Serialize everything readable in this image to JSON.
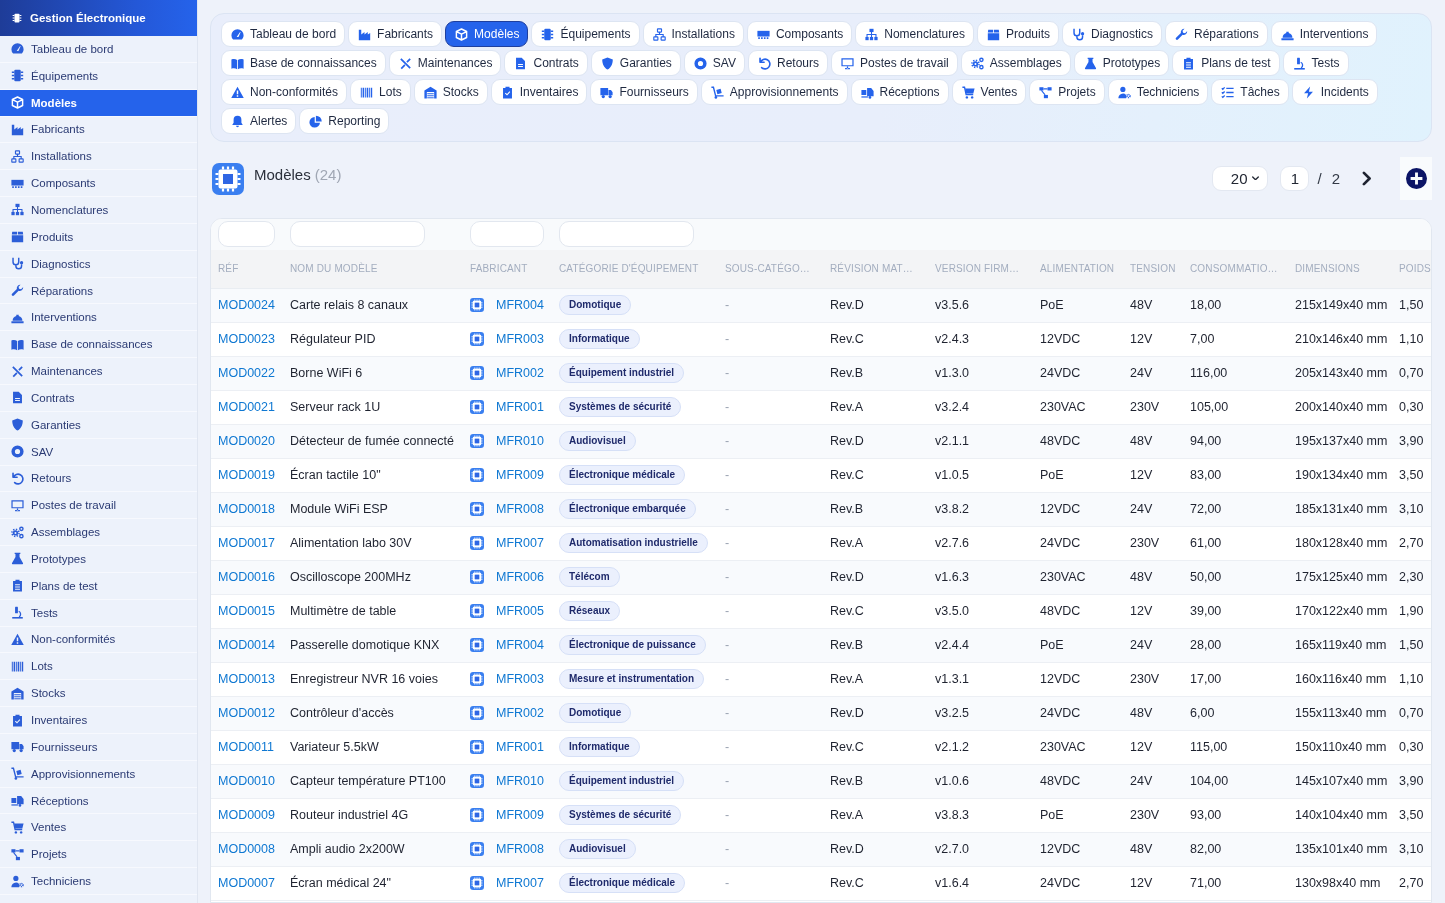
{
  "sidebar": {
    "title": "Gestion Électronique",
    "items": [
      {
        "label": "Tableau de bord",
        "selected": false
      },
      {
        "label": "Équipements",
        "selected": false
      },
      {
        "label": "Modèles",
        "selected": true
      },
      {
        "label": "Fabricants",
        "selected": false
      },
      {
        "label": "Installations",
        "selected": false
      },
      {
        "label": "Composants",
        "selected": false
      },
      {
        "label": "Nomenclatures",
        "selected": false
      },
      {
        "label": "Produits",
        "selected": false
      },
      {
        "label": "Diagnostics",
        "selected": false
      },
      {
        "label": "Réparations",
        "selected": false
      },
      {
        "label": "Interventions",
        "selected": false
      },
      {
        "label": "Base de connaissances",
        "selected": false
      },
      {
        "label": "Maintenances",
        "selected": false
      },
      {
        "label": "Contrats",
        "selected": false
      },
      {
        "label": "Garanties",
        "selected": false
      },
      {
        "label": "SAV",
        "selected": false
      },
      {
        "label": "Retours",
        "selected": false
      },
      {
        "label": "Postes de travail",
        "selected": false
      },
      {
        "label": "Assemblages",
        "selected": false
      },
      {
        "label": "Prototypes",
        "selected": false
      },
      {
        "label": "Plans de test",
        "selected": false
      },
      {
        "label": "Tests",
        "selected": false
      },
      {
        "label": "Non-conformités",
        "selected": false
      },
      {
        "label": "Lots",
        "selected": false
      },
      {
        "label": "Stocks",
        "selected": false
      },
      {
        "label": "Inventaires",
        "selected": false
      },
      {
        "label": "Fournisseurs",
        "selected": false
      },
      {
        "label": "Approvisionnements",
        "selected": false
      },
      {
        "label": "Réceptions",
        "selected": false
      },
      {
        "label": "Ventes",
        "selected": false
      },
      {
        "label": "Projets",
        "selected": false
      },
      {
        "label": "Techniciens",
        "selected": false
      }
    ]
  },
  "tabs": [
    {
      "label": "Tableau de bord",
      "selected": false
    },
    {
      "label": "Fabricants",
      "selected": false
    },
    {
      "label": "Modèles",
      "selected": true
    },
    {
      "label": "Équipements",
      "selected": false
    },
    {
      "label": "Installations",
      "selected": false
    },
    {
      "label": "Composants",
      "selected": false
    },
    {
      "label": "Nomenclatures",
      "selected": false
    },
    {
      "label": "Produits",
      "selected": false
    },
    {
      "label": "Diagnostics",
      "selected": false
    },
    {
      "label": "Réparations",
      "selected": false
    },
    {
      "label": "Interventions",
      "selected": false
    },
    {
      "label": "Base de connaissances",
      "selected": false
    },
    {
      "label": "Maintenances",
      "selected": false
    },
    {
      "label": "Contrats",
      "selected": false
    },
    {
      "label": "Garanties",
      "selected": false
    },
    {
      "label": "SAV",
      "selected": false
    },
    {
      "label": "Retours",
      "selected": false
    },
    {
      "label": "Postes de travail",
      "selected": false
    },
    {
      "label": "Assemblages",
      "selected": false
    },
    {
      "label": "Prototypes",
      "selected": false
    },
    {
      "label": "Plans de test",
      "selected": false
    },
    {
      "label": "Tests",
      "selected": false
    },
    {
      "label": "Non-conformités",
      "selected": false
    },
    {
      "label": "Lots",
      "selected": false
    },
    {
      "label": "Stocks",
      "selected": false
    },
    {
      "label": "Inventaires",
      "selected": false
    },
    {
      "label": "Fournisseurs",
      "selected": false
    },
    {
      "label": "Approvisionnements",
      "selected": false
    },
    {
      "label": "Réceptions",
      "selected": false
    },
    {
      "label": "Ventes",
      "selected": false
    },
    {
      "label": "Projets",
      "selected": false
    },
    {
      "label": "Techniciens",
      "selected": false
    },
    {
      "label": "Tâches",
      "selected": false
    },
    {
      "label": "Incidents",
      "selected": false
    },
    {
      "label": "Alertes",
      "selected": false
    },
    {
      "label": "Reporting",
      "selected": false
    }
  ],
  "page_header": {
    "title": "Modèles",
    "count": "(24)"
  },
  "pagination": {
    "page_size": "20",
    "page": "1",
    "separator": "/",
    "page_count": "2"
  },
  "table": {
    "columns": [
      {
        "label": "RÉF",
        "kind": "link",
        "filterable": true
      },
      {
        "label": "NOM DU MODÈLE",
        "kind": "text",
        "filterable": true
      },
      {
        "label": "FABRICANT",
        "kind": "manufacturer",
        "filterable": true
      },
      {
        "label": "CATÉGORIE D'ÉQUIPEMENT",
        "kind": "tag",
        "filterable": true
      },
      {
        "label": "SOUS-CATÉGO…",
        "kind": "muted",
        "filterable": false
      },
      {
        "label": "RÉVISION MAT…",
        "kind": "text",
        "filterable": false
      },
      {
        "label": "VERSION FIRM…",
        "kind": "text",
        "filterable": false
      },
      {
        "label": "ALIMENTATION",
        "kind": "text",
        "filterable": false
      },
      {
        "label": "TENSION",
        "kind": "text",
        "filterable": false
      },
      {
        "label": "CONSOMMATIO…",
        "kind": "text",
        "filterable": false
      },
      {
        "label": "DIMENSIONS",
        "kind": "text",
        "filterable": false
      },
      {
        "label": "POIDS",
        "kind": "text",
        "filterable": false
      }
    ],
    "rows": [
      {
        "cells": [
          "MOD0024",
          "Carte relais 8 canaux",
          "MFR004",
          "Domotique",
          "-",
          "Rev.D",
          "v3.5.6",
          "PoE",
          "48V",
          "18,00",
          "215x149x40 mm",
          "1,50"
        ]
      },
      {
        "cells": [
          "MOD0023",
          "Régulateur PID",
          "MFR003",
          "Informatique",
          "-",
          "Rev.C",
          "v2.4.3",
          "12VDC",
          "12V",
          "7,00",
          "210x146x40 mm",
          "1,10"
        ]
      },
      {
        "cells": [
          "MOD0022",
          "Borne WiFi 6",
          "MFR002",
          "Équipement industriel",
          "-",
          "Rev.B",
          "v1.3.0",
          "24VDC",
          "24V",
          "116,00",
          "205x143x40 mm",
          "0,70"
        ]
      },
      {
        "cells": [
          "MOD0021",
          "Serveur rack 1U",
          "MFR001",
          "Systèmes de sécurité",
          "-",
          "Rev.A",
          "v3.2.4",
          "230VAC",
          "230V",
          "105,00",
          "200x140x40 mm",
          "0,30"
        ]
      },
      {
        "cells": [
          "MOD0020",
          "Détecteur de fumée connecté",
          "MFR010",
          "Audiovisuel",
          "-",
          "Rev.D",
          "v2.1.1",
          "48VDC",
          "48V",
          "94,00",
          "195x137x40 mm",
          "3,90"
        ]
      },
      {
        "cells": [
          "MOD0019",
          "Écran tactile 10\"",
          "MFR009",
          "Électronique médicale",
          "-",
          "Rev.C",
          "v1.0.5",
          "PoE",
          "12V",
          "83,00",
          "190x134x40 mm",
          "3,50"
        ]
      },
      {
        "cells": [
          "MOD0018",
          "Module WiFi ESP",
          "MFR008",
          "Électronique embarquée",
          "-",
          "Rev.B",
          "v3.8.2",
          "12VDC",
          "24V",
          "72,00",
          "185x131x40 mm",
          "3,10"
        ]
      },
      {
        "cells": [
          "MOD0017",
          "Alimentation labo 30V",
          "MFR007",
          "Automatisation industrielle",
          "-",
          "Rev.A",
          "v2.7.6",
          "24VDC",
          "230V",
          "61,00",
          "180x128x40 mm",
          "2,70"
        ]
      },
      {
        "cells": [
          "MOD0016",
          "Oscilloscope 200MHz",
          "MFR006",
          "Télécom",
          "-",
          "Rev.D",
          "v1.6.3",
          "230VAC",
          "48V",
          "50,00",
          "175x125x40 mm",
          "2,30"
        ]
      },
      {
        "cells": [
          "MOD0015",
          "Multimètre de table",
          "MFR005",
          "Réseaux",
          "-",
          "Rev.C",
          "v3.5.0",
          "48VDC",
          "12V",
          "39,00",
          "170x122x40 mm",
          "1,90"
        ]
      },
      {
        "cells": [
          "MOD0014",
          "Passerelle domotique KNX",
          "MFR004",
          "Électronique de puissance",
          "-",
          "Rev.B",
          "v2.4.4",
          "PoE",
          "24V",
          "28,00",
          "165x119x40 mm",
          "1,50"
        ]
      },
      {
        "cells": [
          "MOD0013",
          "Enregistreur NVR 16 voies",
          "MFR003",
          "Mesure et instrumentation",
          "-",
          "Rev.A",
          "v1.3.1",
          "12VDC",
          "230V",
          "17,00",
          "160x116x40 mm",
          "1,10"
        ]
      },
      {
        "cells": [
          "MOD0012",
          "Contrôleur d'accès",
          "MFR002",
          "Domotique",
          "-",
          "Rev.D",
          "v3.2.5",
          "24VDC",
          "48V",
          "6,00",
          "155x113x40 mm",
          "0,70"
        ]
      },
      {
        "cells": [
          "MOD0011",
          "Variateur 5.5kW",
          "MFR001",
          "Informatique",
          "-",
          "Rev.C",
          "v2.1.2",
          "230VAC",
          "12V",
          "115,00",
          "150x110x40 mm",
          "0,30"
        ]
      },
      {
        "cells": [
          "MOD0010",
          "Capteur température PT100",
          "MFR010",
          "Équipement industriel",
          "-",
          "Rev.B",
          "v1.0.6",
          "48VDC",
          "24V",
          "104,00",
          "145x107x40 mm",
          "3,90"
        ]
      },
      {
        "cells": [
          "MOD0009",
          "Routeur industriel 4G",
          "MFR009",
          "Systèmes de sécurité",
          "-",
          "Rev.A",
          "v3.8.3",
          "PoE",
          "230V",
          "93,00",
          "140x104x40 mm",
          "3,50"
        ]
      },
      {
        "cells": [
          "MOD0008",
          "Ampli audio 2x200W",
          "MFR008",
          "Audiovisuel",
          "-",
          "Rev.D",
          "v2.7.0",
          "12VDC",
          "48V",
          "82,00",
          "135x101x40 mm",
          "3,10"
        ]
      },
      {
        "cells": [
          "MOD0007",
          "Écran médical 24\"",
          "MFR007",
          "Électronique médicale",
          "-",
          "Rev.C",
          "v1.6.4",
          "24VDC",
          "12V",
          "71,00",
          "130x98x40 mm",
          "2,70"
        ]
      }
    ]
  }
}
